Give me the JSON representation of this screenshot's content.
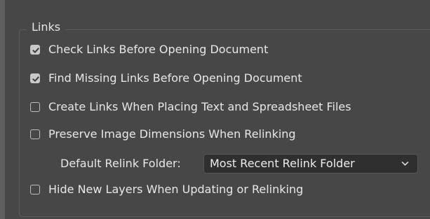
{
  "links_group": {
    "title": "Links",
    "checkboxes": [
      {
        "label": "Check Links Before Opening Document",
        "checked": true
      },
      {
        "label": "Find Missing Links Before Opening Document",
        "checked": true
      },
      {
        "label": "Create Links When Placing Text and Spreadsheet Files",
        "checked": false
      },
      {
        "label": "Preserve Image Dimensions When Relinking",
        "checked": false
      },
      {
        "label": "Hide New Layers When Updating or Relinking",
        "checked": false
      }
    ],
    "relink_folder": {
      "label": "Default Relink Folder:",
      "selected": "Most Recent Relink Folder"
    }
  },
  "icons": {
    "checkmark": "checkmark-icon",
    "dropdown": "chevron-down-icon"
  },
  "colors": {
    "panel_bg": "#474747",
    "outer_bg": "#5f5f5f",
    "select_bg": "#2f2f2f",
    "text": "#e8e8e8",
    "checkbox_fill": "#c9c9c9"
  }
}
